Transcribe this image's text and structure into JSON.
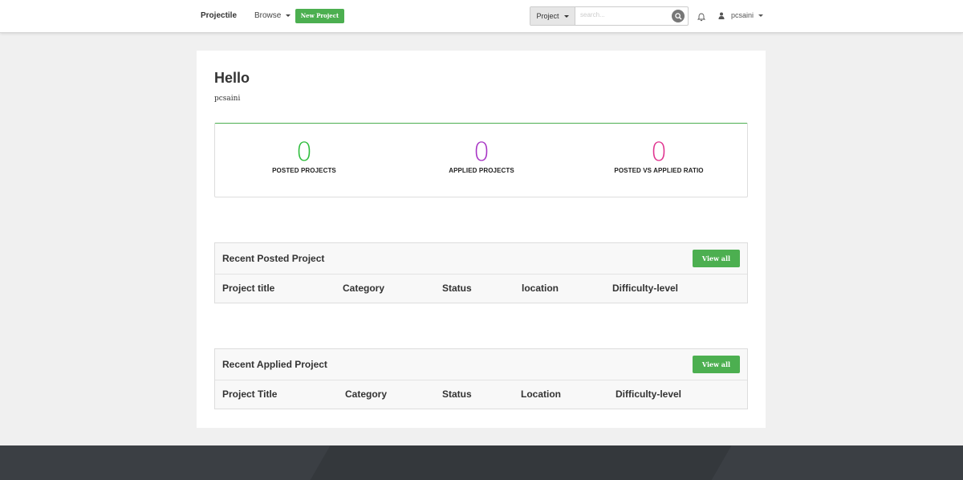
{
  "navbar": {
    "brand": "Projectile",
    "browse_label": "Browse",
    "new_project_label": "New Project",
    "search_category": "Project",
    "search_placeholder": "search...",
    "username": "pcsaini"
  },
  "greeting": {
    "title": "Hello",
    "username": "pcsaini"
  },
  "stats": [
    {
      "value": "0",
      "label": "POSTED PROJECTS",
      "color": "#2ebd3c"
    },
    {
      "value": "0",
      "label": "APPLIED PROJECTS",
      "color": "#a733c4"
    },
    {
      "value": "0",
      "label": "POSTED VS APPLIED RATIO",
      "color": "#e0338f"
    }
  ],
  "posted_panel": {
    "title": "Recent Posted Project",
    "view_all_label": "View all",
    "columns": [
      "Project title",
      "Category",
      "Status",
      "location",
      "Difficulty-level"
    ]
  },
  "applied_panel": {
    "title": "Recent Applied Project",
    "view_all_label": "View all",
    "columns": [
      "Project Title",
      "Category",
      "Status",
      "Location",
      "Difficulty-level"
    ]
  },
  "colors": {
    "accent": "#4caf50",
    "background": "#f0f0f0",
    "footer": "#3b3f44"
  },
  "icons": [
    "search-icon",
    "bell-icon",
    "user-icon",
    "chevron-down-icon"
  ]
}
